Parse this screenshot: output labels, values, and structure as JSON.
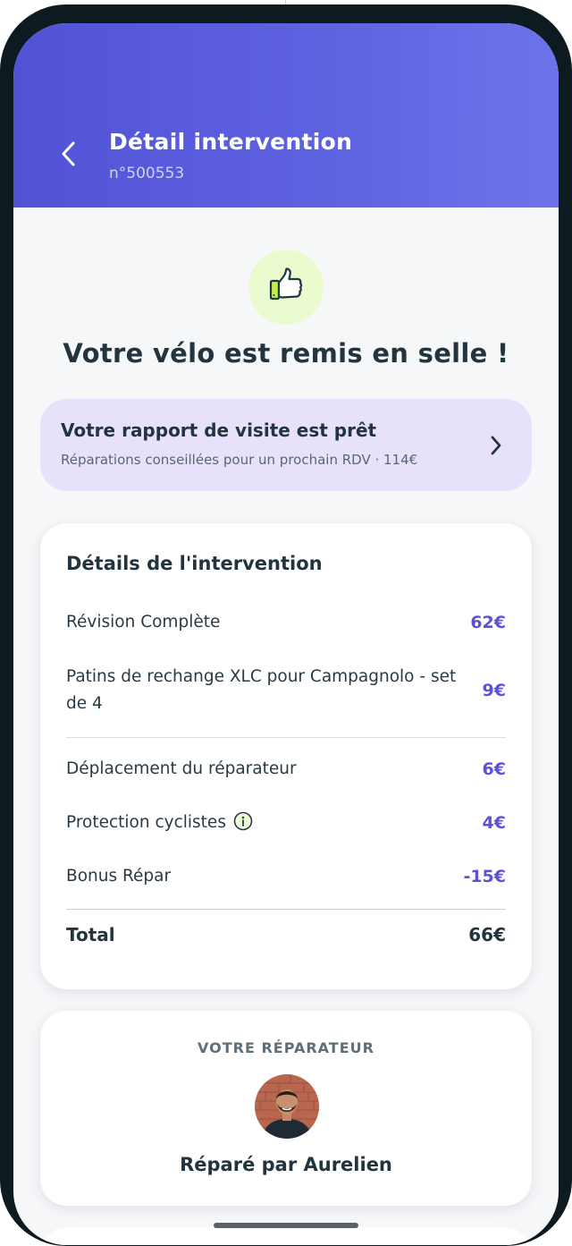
{
  "header": {
    "title": "Détail intervention",
    "subtitle": "n°500553",
    "back_icon": "chevron-left-icon"
  },
  "success": {
    "icon": "thumbs-up-icon",
    "title": "Votre vélo est remis en selle !"
  },
  "report": {
    "title": "Votre rapport de visite est prêt",
    "subtitle": "Réparations conseillées pour un prochain RDV · 114€",
    "chevron_icon": "chevron-right-icon"
  },
  "details": {
    "title": "Détails de l'intervention",
    "items": [
      {
        "label": "Révision Complète",
        "price": "62€"
      },
      {
        "label": "Patins de rechange XLC pour Campagnolo - set de 4",
        "price": "9€"
      }
    ],
    "fees": [
      {
        "label": "Déplacement du réparateur",
        "price": "6€"
      },
      {
        "label": "Protection cyclistes",
        "price": "4€",
        "info_icon": "info-icon"
      },
      {
        "label": "Bonus Répar",
        "price": "-15€"
      }
    ],
    "total_label": "Total",
    "total_price": "66€"
  },
  "repairer": {
    "heading": "VOTRE RÉPARATEUR",
    "repaired_by": "Réparé par Aurelien"
  },
  "colors": {
    "header_gradient_start": "#5252d6",
    "header_gradient_end": "#6c74ea",
    "accent_price": "#5a52d9",
    "report_card_bg": "#e7e1fb",
    "thumb_circle_bg": "#eafbcf",
    "text_dark": "#22343d"
  }
}
